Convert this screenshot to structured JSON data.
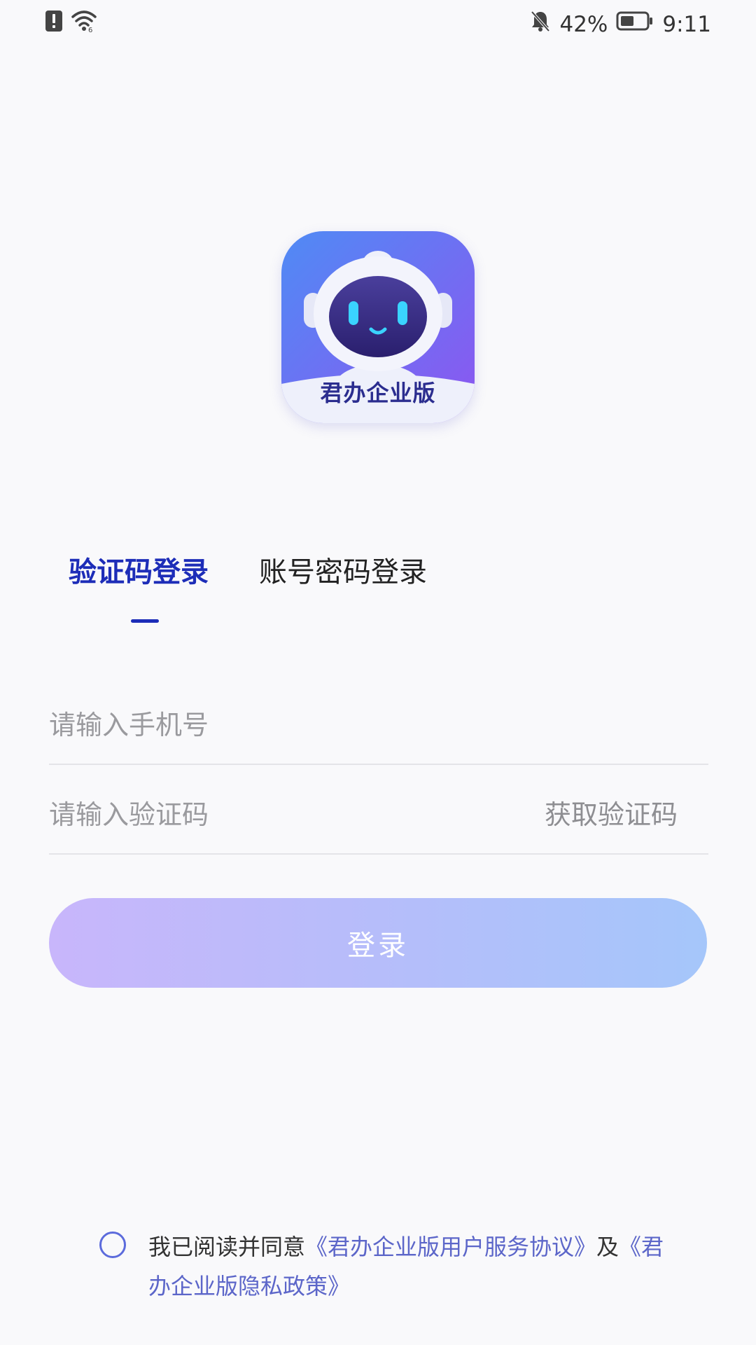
{
  "status_bar": {
    "battery_percent": "42%",
    "time": "9:11",
    "icons": [
      "alert-icon",
      "wifi-icon",
      "bell-off-icon",
      "battery-icon"
    ]
  },
  "logo": {
    "text": "君办企业版"
  },
  "tabs": [
    {
      "label": "验证码登录",
      "active": true
    },
    {
      "label": "账号密码登录",
      "active": false
    }
  ],
  "form": {
    "phone_placeholder": "请输入手机号",
    "phone_value": "",
    "code_placeholder": "请输入验证码",
    "code_value": "",
    "get_code_label": "获取验证码",
    "login_label": "登录"
  },
  "agreement": {
    "prefix": "我已阅读并同意",
    "service_link": "《君办企业版用户服务协议》",
    "conjunction": "及",
    "privacy_link": "《君办企业版隐私政策》",
    "checked": false
  },
  "colors": {
    "accent": "#1d2db8",
    "link": "#5c66c9",
    "button_gradient_start": "#c8b6fb",
    "button_gradient_end": "#a5c6fa"
  }
}
